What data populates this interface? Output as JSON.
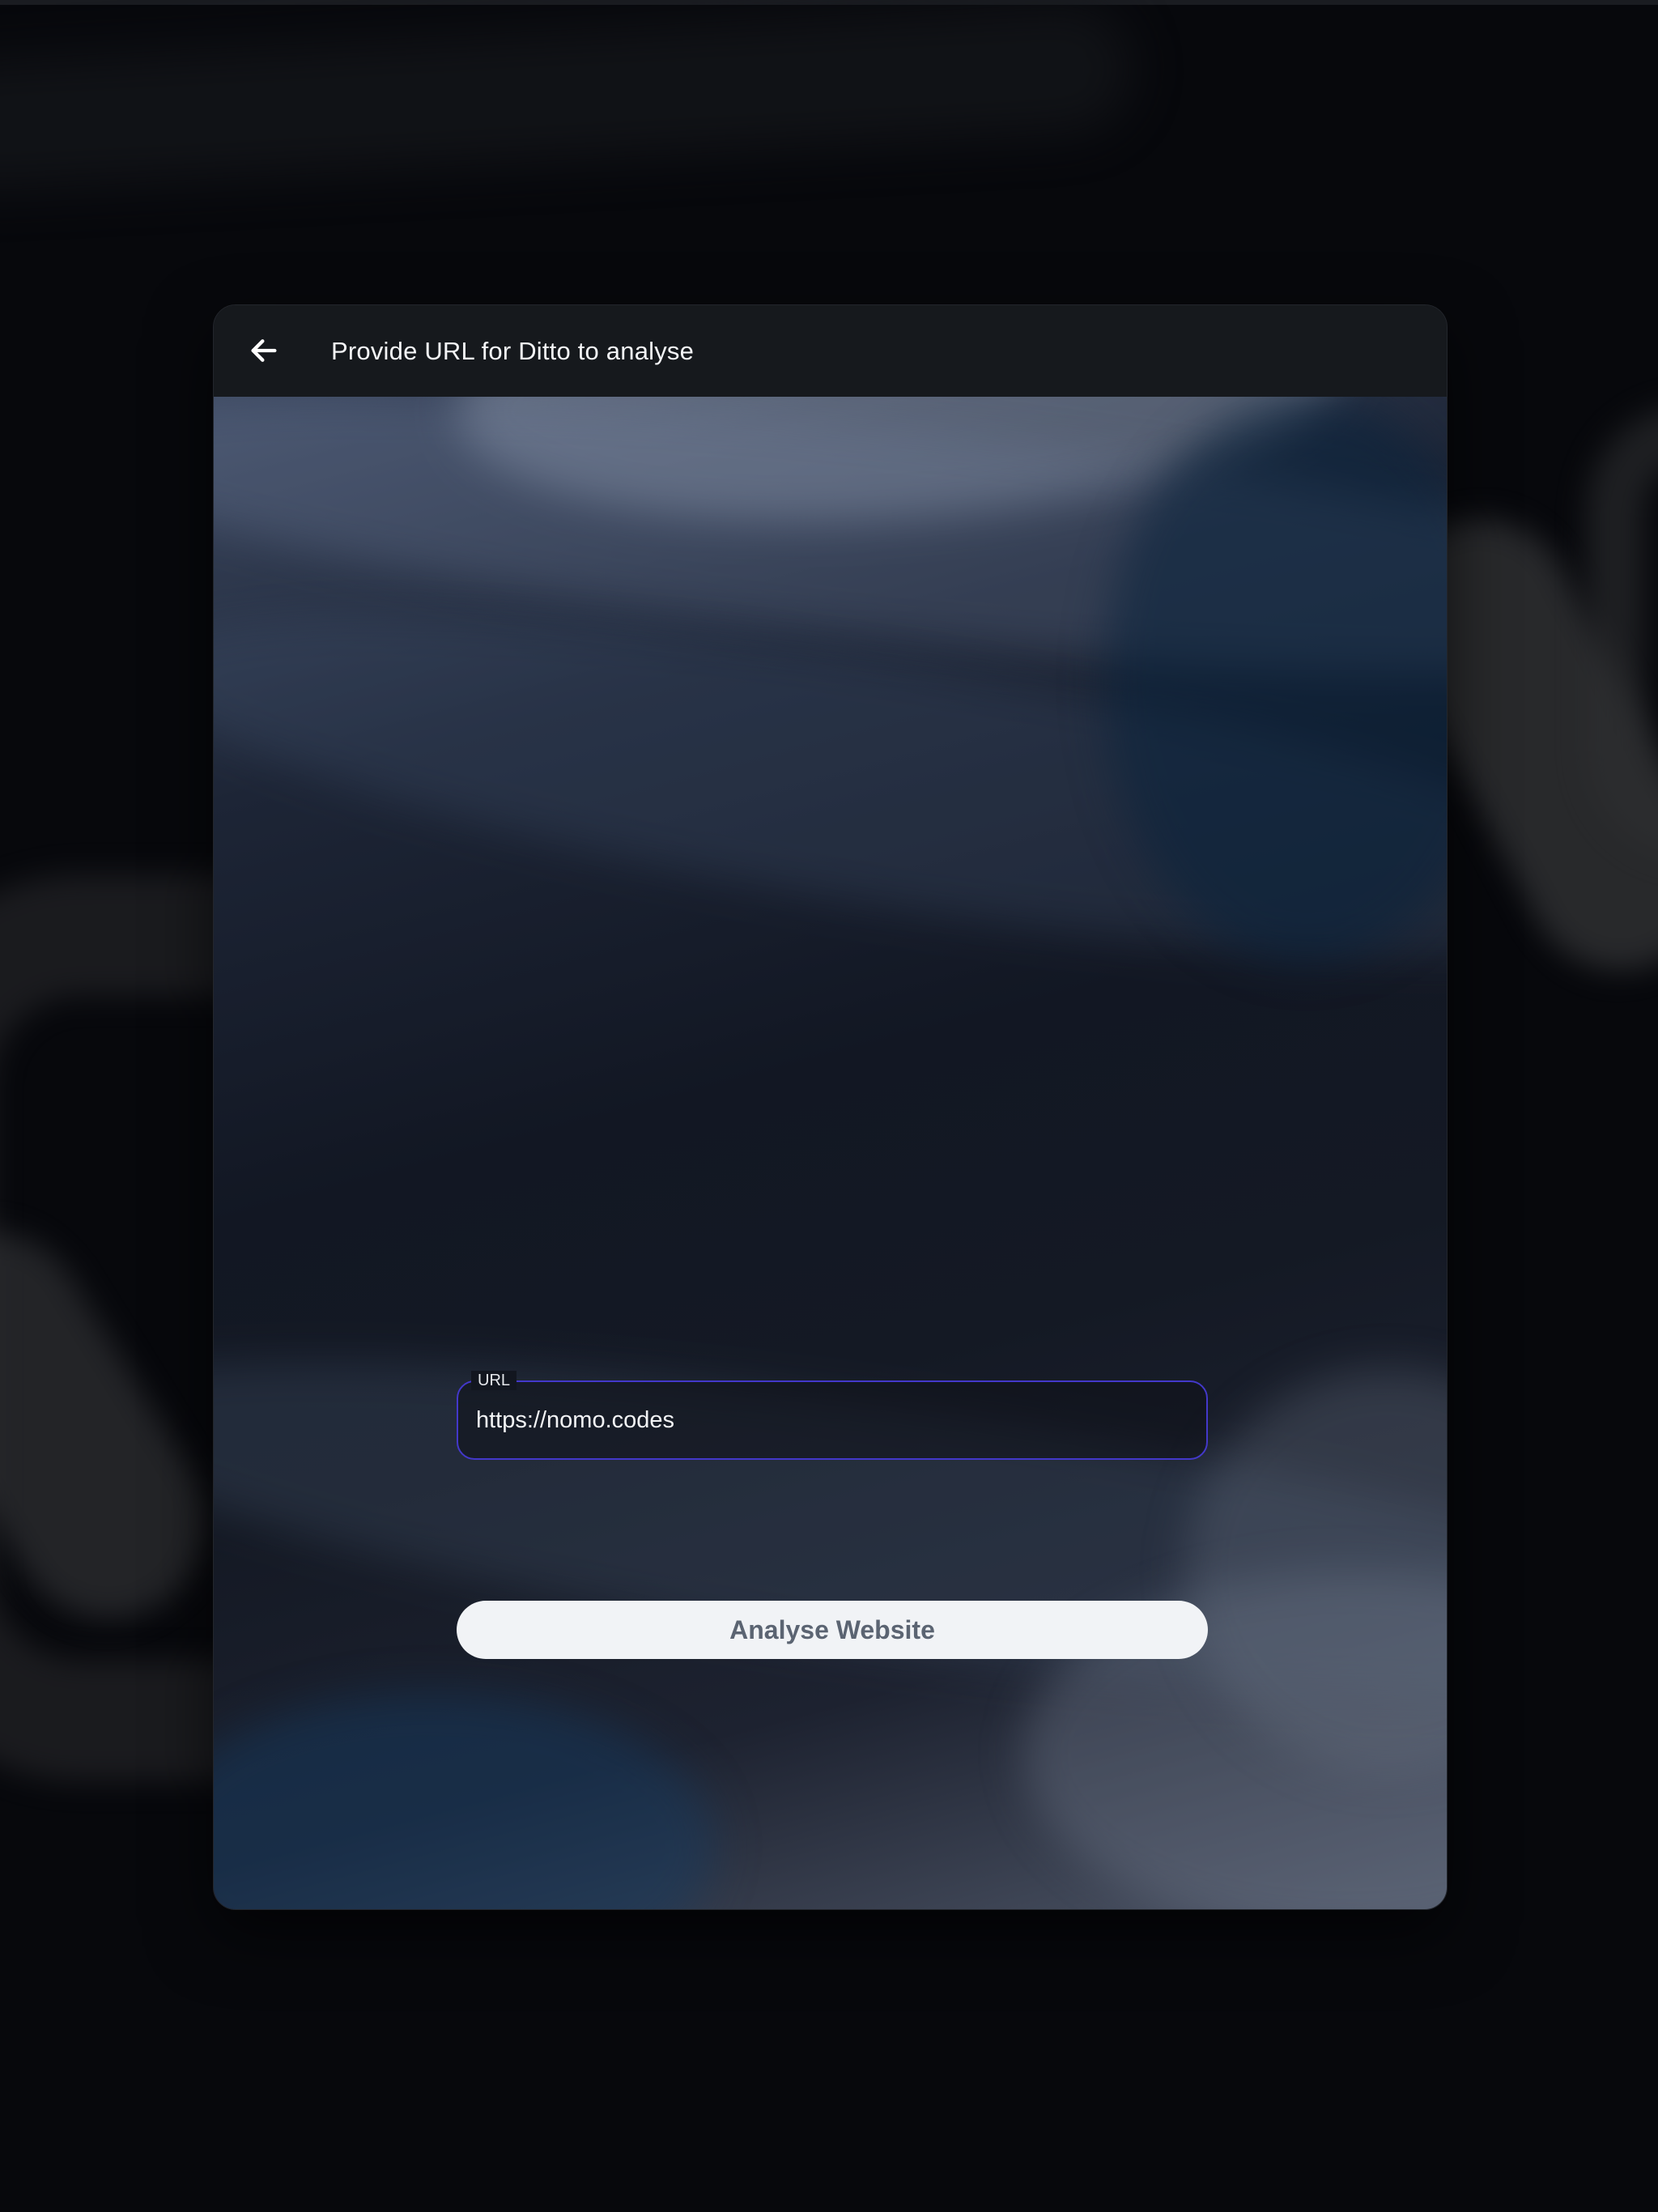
{
  "header": {
    "title": "Provide URL for Ditto to analyse",
    "back_icon": "arrow-left-icon"
  },
  "form": {
    "url_label": "URL",
    "url_value": "https://nomo.codes",
    "submit_label": "Analyse Website"
  },
  "colors": {
    "accent_border": "#4338ca",
    "button_bg": "#f1f3f6",
    "button_text": "#5b6472",
    "titlebar_bg": "#16191d"
  }
}
